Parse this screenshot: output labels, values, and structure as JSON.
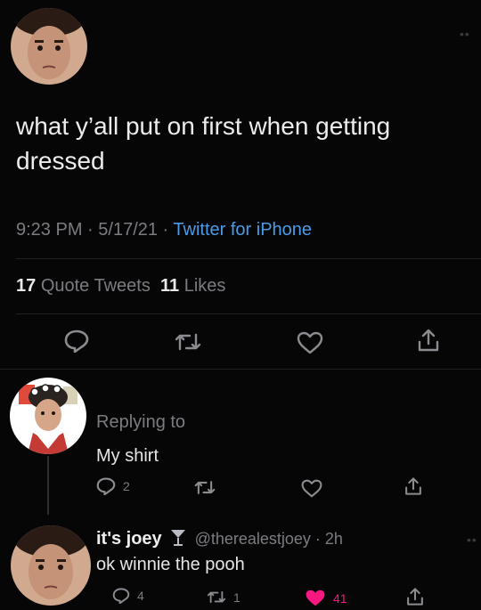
{
  "main_tweet": {
    "text": "what y’all put on first when getting dressed",
    "time": "9:23 PM",
    "date": "5/17/21",
    "client": "Twitter for iPhone",
    "quote_tweets_count": "17",
    "quote_tweets_label": "Quote Tweets",
    "likes_count": "11",
    "likes_label": "Likes",
    "more_icon": "more-dots-icon"
  },
  "reply_1": {
    "replying_to_label": "Replying to",
    "text": "My shirt",
    "reply_count": "2"
  },
  "reply_2": {
    "display_name": "it's joey",
    "handle": "@therealestjoey",
    "age": "2h",
    "text": "ok winnie the pooh",
    "reply_count": "4",
    "retweet_count": "1",
    "like_count": "41"
  },
  "colors": {
    "background": "#060607",
    "link": "#4a9ce8",
    "like_active": "#f91880"
  }
}
